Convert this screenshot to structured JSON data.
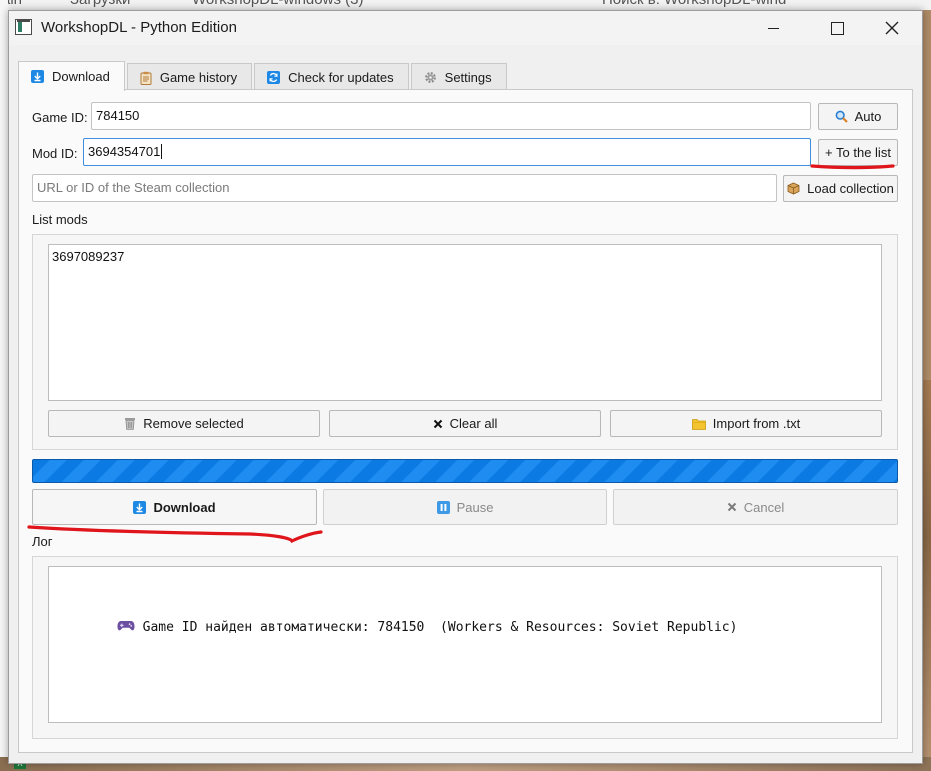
{
  "window": {
    "title": "WorkshopDL - Python Edition",
    "controls": [
      "minimize",
      "maximize",
      "close"
    ]
  },
  "background": {
    "behind_title_left": "ain",
    "behind_breadcrumb_1": "Загрузки",
    "behind_breadcrumb_2": "WorkshopDL-windows (3)",
    "behind_search": "Поиск в: WorkshopDL-wind",
    "taskbar_icon": "X"
  },
  "tabs": [
    {
      "label": "Download",
      "icon": "download-icon",
      "active": true
    },
    {
      "label": "Game history",
      "icon": "clipboard-icon",
      "active": false
    },
    {
      "label": "Check for updates",
      "icon": "refresh-icon",
      "active": false
    },
    {
      "label": "Settings",
      "icon": "gear-icon",
      "active": false
    }
  ],
  "form": {
    "game_id_label": "Game ID:",
    "game_id_value": "784150",
    "auto_button": "Auto",
    "mod_id_label": "Mod ID:",
    "mod_id_value": "3694354701",
    "to_list_button": "+ To the list",
    "collection_placeholder": "URL or ID of the Steam collection",
    "load_collection_button": "Load collection"
  },
  "mods": {
    "label": "List mods",
    "items": [
      "3697089237"
    ],
    "remove_button": "Remove selected",
    "clear_button": "Clear all",
    "import_button": "Import from .txt"
  },
  "progress": {
    "state": "busy",
    "color": "#0b7ae3"
  },
  "actions": {
    "download_button": "Download",
    "pause_button": "Pause",
    "cancel_button": "Cancel"
  },
  "log": {
    "label": "Лог",
    "lines": [
      {
        "icon": "gamepad-icon",
        "text": "Game ID найден автоматически: 784150  (Workers & Resources: Soviet Republic)"
      }
    ]
  },
  "colors": {
    "accent": "#0b7ae3",
    "annotation": "#e0141b",
    "focus_border": "#3e8ede"
  }
}
